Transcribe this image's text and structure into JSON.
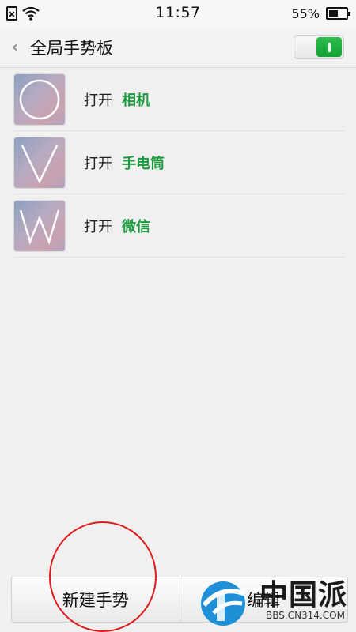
{
  "status_bar": {
    "time": "11:57",
    "battery": "55%",
    "battery_level": 0.55,
    "icons": [
      "sim-absent-icon",
      "wifi-icon",
      "battery-icon"
    ]
  },
  "header": {
    "back_icon": "chevron-left-icon",
    "title": "全局手势板",
    "toggle_on": true,
    "toggle_color": "#1ea33b"
  },
  "gestures": [
    {
      "glyph": "circle",
      "action": "打开",
      "target": "相机"
    },
    {
      "glyph": "V",
      "action": "打开",
      "target": "手电筒"
    },
    {
      "glyph": "W",
      "action": "打开",
      "target": "微信"
    }
  ],
  "bottom_bar": {
    "new_label": "新建手势",
    "edit_label": "编辑"
  },
  "colors": {
    "accent_green": "#1e9a3e",
    "annotation_red": "#e01a1a"
  },
  "watermark": {
    "title": "中国派",
    "url": "BBS.CN314.COM"
  }
}
